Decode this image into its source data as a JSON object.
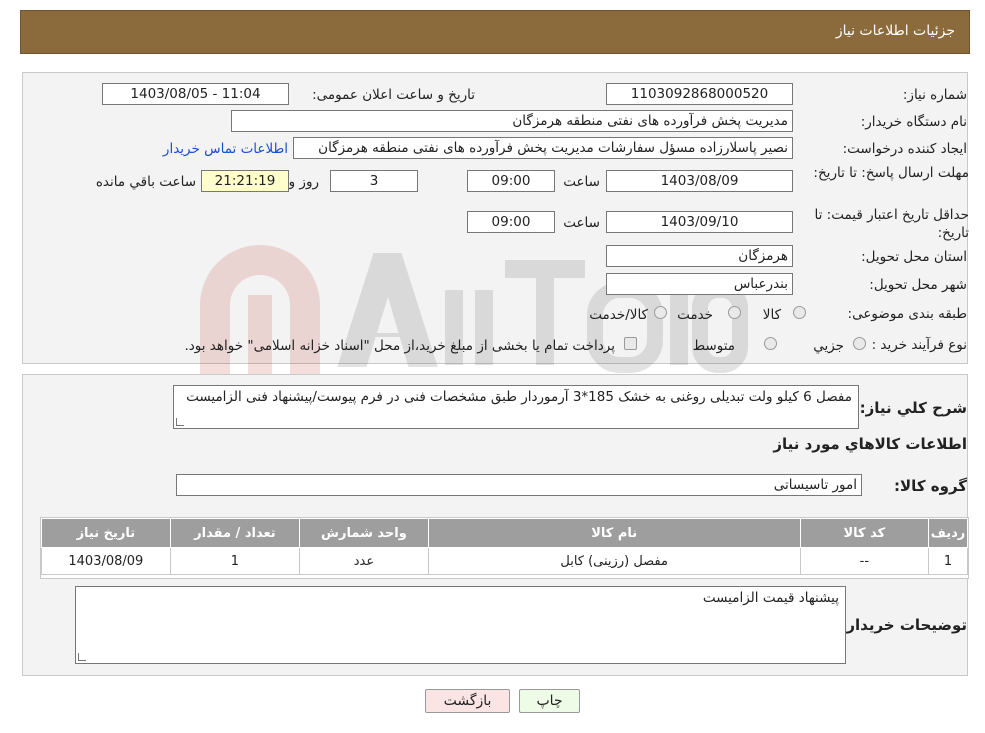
{
  "header": {
    "title": "جزئیات اطلاعات نیاز"
  },
  "form": {
    "need_number_label": "شماره نیاز:",
    "need_number": "1103092868000520",
    "announce_label": "تاریخ و ساعت اعلان عمومی:",
    "announce_value": "1403/08/05 - 11:04",
    "buyer_org_label": "نام دستگاه خریدار:",
    "buyer_org": "مدیریت پخش فرآورده های نفتی منطقه هرمزگان",
    "creator_label": "ایجاد کننده درخواست:",
    "creator": "نصیر پاسلارزاده مسؤل سفارشات مدیریت پخش فرآورده های نفتی منطقه هرمزگان",
    "contact_link": "اطلاعات تماس خریدار",
    "deadline_label": "مهلت ارسال پاسخ: تا تاریخ:",
    "deadline_date": "1403/08/09",
    "time_label": "ساعت",
    "deadline_time": "09:00",
    "days_value": "3",
    "days_label": "روز و",
    "remaining_time": "21:21:19",
    "remaining_label": "ساعت باقي مانده",
    "validity_label": "حداقل تاریخ اعتبار قیمت: تا تاریخ:",
    "validity_date": "1403/09/10",
    "validity_time": "09:00",
    "province_label": "استان محل تحویل:",
    "province": "هرمزگان",
    "city_label": "شهر محل تحویل:",
    "city": "بندرعباس",
    "category_label": "طبقه بندی موضوعی:",
    "category_options": [
      "كالا",
      "خدمت",
      "كالا/خدمت"
    ],
    "purchase_label": "نوع فرآیند خرید :",
    "purchase_options": [
      "جزيي",
      "متوسط"
    ],
    "purchase_note": "پرداخت تمام یا بخشی از مبلغ خرید،از محل \"اسناد خزانه اسلامی\" خواهد بود."
  },
  "details": {
    "summary_label": "شرح كلي نياز:",
    "summary": "مفصل 6 کیلو ولت تبدیلی روغنی به خشک 185*3 آرموردار طبق مشخصات فنی در فرم پیوست/پیشنهاد فنی الزامیست",
    "goods_heading": "اطلاعات كالاهاي مورد نياز",
    "group_label": "گروه كالا:",
    "group_value": "امور تاسیساتی",
    "table": {
      "headers": [
        "رديف",
        "كد كالا",
        "نام كالا",
        "واحد شمارش",
        "تعداد / مقدار",
        "تاريخ نياز"
      ],
      "rows": [
        [
          "1",
          "--",
          "مفصل (رزینی) کابل",
          "عدد",
          "1",
          "1403/08/09"
        ]
      ]
    },
    "buyer_notes_label": "توضیحات خریدار:",
    "buyer_notes": "پیشنهاد قیمت الزامیست"
  },
  "buttons": {
    "print": "چاپ",
    "back": "بازگشت"
  },
  "colors": {
    "header_bg": "#8b6a3c",
    "table_header_bg": "#9e9e9e",
    "print_btn_bg": "#eefbe6",
    "back_btn_bg": "#fbe4e4",
    "link": "#1a4fd0"
  }
}
